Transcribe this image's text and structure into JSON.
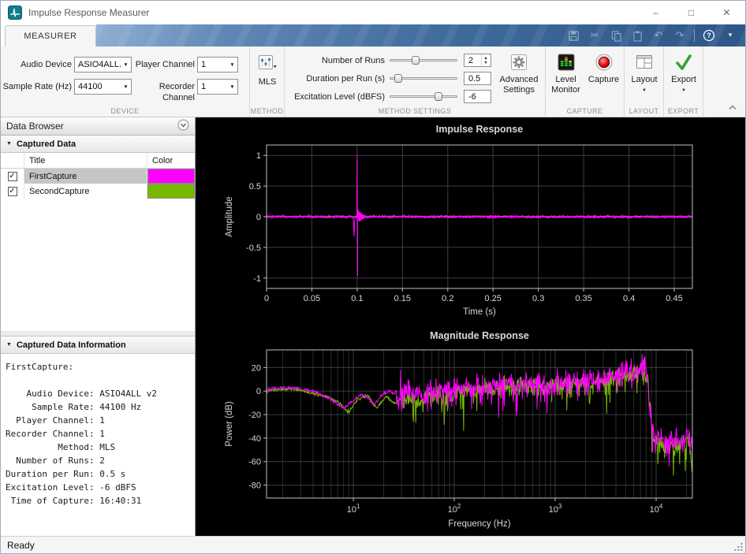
{
  "window": {
    "title": "Impulse Response Measurer"
  },
  "ribbon": {
    "tab": "MEASURER"
  },
  "toolstrip": {
    "device": {
      "section_label": "DEVICE",
      "audio_device": {
        "label": "Audio Device",
        "value": "ASIO4ALL..."
      },
      "sample_rate": {
        "label": "Sample Rate (Hz)",
        "value": "44100"
      },
      "player_channel": {
        "label": "Player Channel",
        "value": "1"
      },
      "recorder_channel": {
        "label": "Recorder Channel",
        "value": "1"
      }
    },
    "method": {
      "section_label": "METHOD",
      "button": "MLS"
    },
    "method_settings": {
      "section_label": "METHOD SETTINGS",
      "number_of_runs": {
        "label": "Number of Runs",
        "value": "2",
        "slider_pos": 0.38
      },
      "duration_per_run": {
        "label": "Duration per Run (s)",
        "value": "0.5",
        "slider_pos": 0.13
      },
      "excitation_level": {
        "label": "Excitation Level (dBFS)",
        "value": "-6",
        "slider_pos": 0.72
      },
      "advanced_settings": {
        "line1": "Advanced",
        "line2": "Settings"
      }
    },
    "capture": {
      "section_label": "CAPTURE",
      "level_monitor": {
        "line1": "Level",
        "line2": "Monitor"
      },
      "capture_button": "Capture"
    },
    "layout": {
      "section_label": "LAYOUT",
      "button": "Layout"
    },
    "export": {
      "section_label": "EXPORT",
      "button": "Export"
    }
  },
  "data_browser": {
    "header": "Data Browser",
    "captured_data": {
      "header": "Captured Data",
      "columns": {
        "title": "Title",
        "color": "Color"
      },
      "rows": [
        {
          "title": "FirstCapture",
          "color": "#FF00FF",
          "checked": true,
          "selected": true
        },
        {
          "title": "SecondCapture",
          "color": "#77B900",
          "checked": true,
          "selected": false
        }
      ]
    },
    "info": {
      "header": "Captured Data Information",
      "text": "FirstCapture:\n\n    Audio Device: ASIO4ALL v2\n     Sample Rate: 44100 Hz\n  Player Channel: 1\nRecorder Channel: 1\n          Method: MLS\n  Number of Runs: 2\nDuration per Run: 0.5 s\nExcitation Level: -6 dBFS\n Time of Capture: 16:40:31"
    }
  },
  "status": "Ready",
  "chart_data": [
    {
      "type": "line",
      "title": "Impulse Response",
      "xlabel": "Time (s)",
      "ylabel": "Amplitude",
      "xlim": [
        0,
        0.47
      ],
      "ylim": [
        -1.17,
        1.17
      ],
      "xticks": [
        0,
        0.05,
        0.1,
        0.15,
        0.2,
        0.25,
        0.3,
        0.35,
        0.4,
        0.45
      ],
      "xtick_labels": [
        "0",
        "0.05",
        "0.1",
        "0.15",
        "0.2",
        "0.25",
        "0.3",
        "0.35",
        "0.4",
        "0.45"
      ],
      "yticks": [
        -1,
        -0.5,
        0,
        0.5,
        1
      ],
      "ytick_labels": [
        "-1",
        "-0.5",
        "0",
        "0.5",
        "1"
      ],
      "grid": true,
      "series": [
        {
          "name": "SecondCapture",
          "color": "#77B900",
          "seed": 77,
          "impulse": {
            "t": 0.1,
            "amp": 0.92,
            "neg_amp": 0.9,
            "ring_amp": 0.1,
            "ring_decay": 260,
            "ring_freq": 700,
            "noise": 0.005
          }
        },
        {
          "name": "FirstCapture",
          "color": "#FF00FF",
          "seed": 13,
          "impulse": {
            "t": 0.1,
            "amp": 1.0,
            "neg_amp": 0.97,
            "ring_amp": 0.16,
            "ring_decay": 230,
            "ring_freq": 850,
            "noise": 0.01,
            "pre": {
              "t": 0.0965,
              "amp": -0.32,
              "width": 0.0005
            }
          }
        }
      ]
    },
    {
      "type": "line",
      "title": "Magnitude Response",
      "xlabel": "Frequency (Hz)",
      "ylabel": "Power (dB)",
      "xscale": "log",
      "xlim": [
        1.38,
        22900
      ],
      "ylim": [
        -91,
        35
      ],
      "xticks": [
        10,
        100,
        1000,
        10000
      ],
      "xtick_exp": true,
      "yticks": [
        20,
        0,
        -20,
        -40,
        -60,
        -80
      ],
      "ytick_labels": [
        "20",
        "0",
        "-20",
        "-40",
        "-60",
        "-80"
      ],
      "grid": true,
      "series": [
        {
          "name": "SecondCapture",
          "color": "#77B900",
          "seed": 5,
          "noise": 4,
          "noise_start": 30,
          "spike_prob": 0.17,
          "spike_max": 34,
          "envelope": [
            [
              1.4,
              0
            ],
            [
              2.5,
              2
            ],
            [
              4,
              -2
            ],
            [
              5.5,
              -5
            ],
            [
              7,
              -9
            ],
            [
              9,
              -18
            ],
            [
              11,
              -7
            ],
            [
              14,
              -4
            ],
            [
              17,
              -14
            ],
            [
              21,
              -5
            ],
            [
              26,
              -10
            ],
            [
              33,
              -4
            ],
            [
              45,
              -9
            ],
            [
              60,
              -2
            ],
            [
              80,
              -7
            ],
            [
              100,
              0
            ],
            [
              150,
              2
            ],
            [
              300,
              3
            ],
            [
              600,
              4
            ],
            [
              1000,
              5
            ],
            [
              2000,
              7
            ],
            [
              4000,
              11
            ],
            [
              6000,
              15
            ],
            [
              7600,
              19
            ],
            [
              8300,
              9
            ],
            [
              8900,
              -22
            ],
            [
              9500,
              -40
            ],
            [
              12000,
              -45
            ],
            [
              16000,
              -47
            ],
            [
              20000,
              -43
            ],
            [
              22900,
              -45
            ]
          ]
        },
        {
          "name": "FirstCapture",
          "color": "#FF00FF",
          "seed": 42,
          "noise": 5,
          "noise_start": 26,
          "spike_prob": 0.2,
          "spike_max": 30,
          "envelope": [
            [
              1.38,
              2
            ],
            [
              2.5,
              3
            ],
            [
              4,
              0
            ],
            [
              6,
              -7
            ],
            [
              8,
              -15
            ],
            [
              10,
              -8
            ],
            [
              12,
              -3
            ],
            [
              14,
              -6
            ],
            [
              16,
              -12
            ],
            [
              19,
              -3
            ],
            [
              23,
              0
            ],
            [
              28,
              -5
            ],
            [
              35,
              2
            ],
            [
              50,
              -2
            ],
            [
              70,
              3
            ],
            [
              100,
              3
            ],
            [
              200,
              4
            ],
            [
              400,
              5
            ],
            [
              700,
              6
            ],
            [
              1000,
              7
            ],
            [
              2000,
              9
            ],
            [
              3000,
              11
            ],
            [
              4500,
              14
            ],
            [
              6000,
              17
            ],
            [
              7300,
              21
            ],
            [
              8000,
              18
            ],
            [
              8500,
              0
            ],
            [
              9000,
              -30
            ],
            [
              9800,
              -40
            ],
            [
              12000,
              -42
            ],
            [
              16000,
              -44
            ],
            [
              20000,
              -40
            ],
            [
              22900,
              -42
            ]
          ]
        }
      ]
    }
  ]
}
